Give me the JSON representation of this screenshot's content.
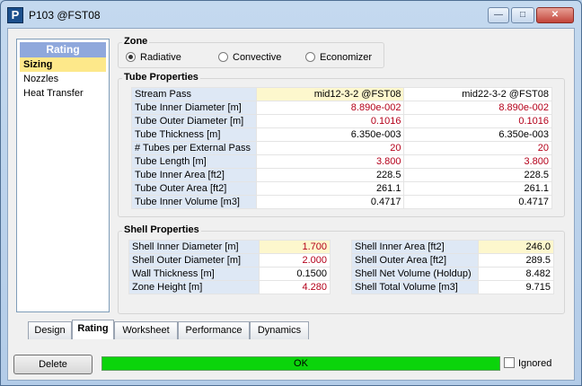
{
  "window": {
    "title": "P103 @FST08",
    "app_icon": "P"
  },
  "nav": {
    "header": "Rating",
    "items": [
      {
        "label": "Sizing",
        "selected": true
      },
      {
        "label": "Nozzles",
        "selected": false
      },
      {
        "label": "Heat Transfer",
        "selected": false
      }
    ]
  },
  "zone": {
    "title": "Zone",
    "options": [
      {
        "label": "Radiative",
        "selected": true
      },
      {
        "label": "Convective",
        "selected": false
      },
      {
        "label": "Economizer",
        "selected": false
      }
    ]
  },
  "tube_properties": {
    "title": "Tube Properties",
    "header": {
      "label": "Stream Pass",
      "col1": "mid12-3-2 @FST08",
      "col2": "mid22-3-2 @FST08"
    },
    "rows": [
      {
        "label": "Tube Inner Diameter [m]",
        "col1": "8.890e-002",
        "col2": "8.890e-002",
        "user_specified": true
      },
      {
        "label": "Tube Outer Diameter [m]",
        "col1": "0.1016",
        "col2": "0.1016",
        "user_specified": true
      },
      {
        "label": "Tube Thickness [m]",
        "col1": "6.350e-003",
        "col2": "6.350e-003",
        "user_specified": false
      },
      {
        "label": "# Tubes per External Pass",
        "col1": "20",
        "col2": "20",
        "user_specified": true
      },
      {
        "label": "Tube Length [m]",
        "col1": "3.800",
        "col2": "3.800",
        "user_specified": true
      },
      {
        "label": "Tube Inner Area [ft2]",
        "col1": "228.5",
        "col2": "228.5",
        "user_specified": false
      },
      {
        "label": "Tube Outer Area [ft2]",
        "col1": "261.1",
        "col2": "261.1",
        "user_specified": false
      },
      {
        "label": "Tube Inner Volume [m3]",
        "col1": "0.4717",
        "col2": "0.4717",
        "user_specified": false
      }
    ]
  },
  "shell_properties": {
    "title": "Shell Properties",
    "left_rows": [
      {
        "label": "Shell Inner Diameter [m]",
        "value": "1.700",
        "user_specified": true
      },
      {
        "label": "Shell Outer Diameter [m]",
        "value": "2.000",
        "user_specified": true
      },
      {
        "label": "Wall Thickness [m]",
        "value": "0.1500",
        "user_specified": false
      },
      {
        "label": "Zone Height [m]",
        "value": "4.280",
        "user_specified": true
      }
    ],
    "right_rows": [
      {
        "label": "Shell Inner Area [ft2]",
        "value": "246.0",
        "user_specified": false
      },
      {
        "label": "Shell Outer Area [ft2]",
        "value": "289.5",
        "user_specified": false
      },
      {
        "label": "Shell Net Volume (Holdup)",
        "value": "8.482",
        "user_specified": false
      },
      {
        "label": "Shell Total Volume [m3]",
        "value": "9.715",
        "user_specified": false
      }
    ]
  },
  "tabs": [
    {
      "label": "Design",
      "active": false
    },
    {
      "label": "Rating",
      "active": true
    },
    {
      "label": "Worksheet",
      "active": false
    },
    {
      "label": "Performance",
      "active": false
    },
    {
      "label": "Dynamics",
      "active": false
    }
  ],
  "footer": {
    "delete_label": "Delete",
    "status": "OK",
    "status_color": "#0bd40b",
    "ignored_label": "Ignored",
    "ignored_checked": false
  },
  "colors": {
    "user_value": "#b4001a",
    "label_bg": "#dee8f5",
    "highlight": "#fdf7cd",
    "nav_header": "#8fa8dc",
    "nav_selected": "#fde88a"
  },
  "icons": {
    "minimize": "minimize-icon",
    "maximize": "maximize-icon",
    "close": "close-icon",
    "app": "app-icon"
  }
}
